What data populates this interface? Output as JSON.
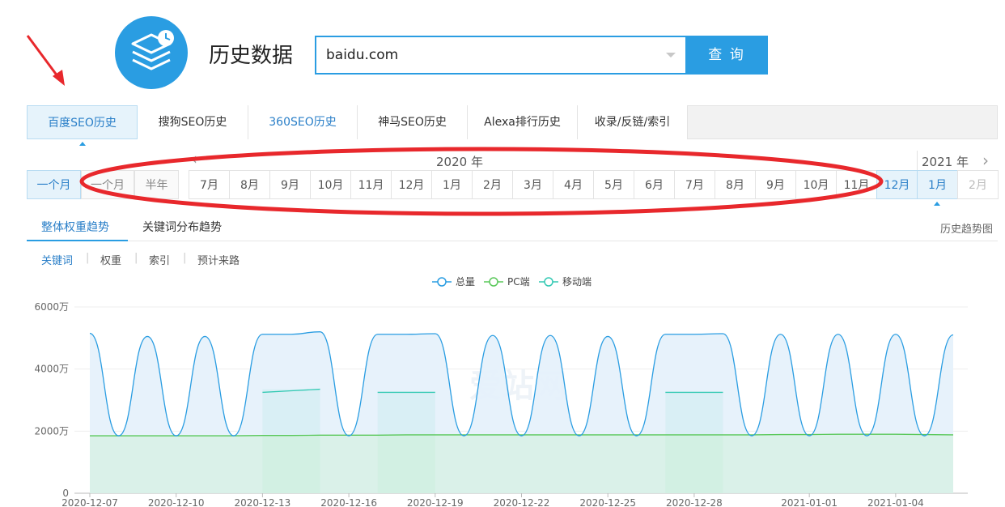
{
  "header": {
    "title": "历史数据",
    "search_value": "baidu.com",
    "search_button": "查 询"
  },
  "tabs": [
    {
      "label": "百度SEO历史",
      "state": "active"
    },
    {
      "label": "搜狗SEO历史",
      "state": "normal"
    },
    {
      "label": "360SEO历史",
      "state": "blue"
    },
    {
      "label": "神马SEO历史",
      "state": "normal"
    },
    {
      "label": "Alexa排行历史",
      "state": "normal"
    },
    {
      "label": "收录/反链/索引",
      "state": "normal"
    }
  ],
  "range": {
    "options": [
      "一个月",
      "一个月",
      "半年"
    ]
  },
  "months": {
    "year_2020": "2020 年",
    "year_2021": "2021 年",
    "list": [
      "7月",
      "8月",
      "9月",
      "10月",
      "11月",
      "12月",
      "1月",
      "2月",
      "3月",
      "4月",
      "5月",
      "6月",
      "7月",
      "8月",
      "9月",
      "10月",
      "11月",
      "12月",
      "1月",
      "2月"
    ],
    "highlighted": [
      "12月",
      "1月"
    ],
    "disabled": [
      "2月"
    ]
  },
  "subtabs": {
    "items": [
      "整体权重趋势",
      "关键词分布趋势"
    ],
    "right_label": "历史趋势图"
  },
  "filters": [
    "关键词",
    "权重",
    "索引",
    "预计来路"
  ],
  "colors": {
    "accent": "#2a9de2",
    "total": "#2a9de2",
    "pc": "#5ac85a",
    "mobile": "#33c9b3",
    "annotation": "#e8282c"
  },
  "watermark": "爱站网",
  "chart_data": {
    "type": "area",
    "legend": [
      "总量",
      "PC端",
      "移动端"
    ],
    "legend_position": "top-center",
    "y_ticks": [
      "6000万",
      "4000万",
      "2000万",
      "0"
    ],
    "ylim": [
      0,
      6000
    ],
    "unit": "万",
    "x_ticks": [
      "2020-12-07",
      "2020-12-10",
      "2020-12-13",
      "2020-12-16",
      "2020-12-19",
      "2020-12-22",
      "2020-12-25",
      "2020-12-28",
      "2021-01-01",
      "2021-01-04"
    ],
    "x": [
      "2020-12-07",
      "2020-12-08",
      "2020-12-09",
      "2020-12-10",
      "2020-12-11",
      "2020-12-12",
      "2020-12-13",
      "2020-12-14",
      "2020-12-15",
      "2020-12-16",
      "2020-12-17",
      "2020-12-18",
      "2020-12-19",
      "2020-12-20",
      "2020-12-21",
      "2020-12-22",
      "2020-12-23",
      "2020-12-24",
      "2020-12-25",
      "2020-12-26",
      "2020-12-27",
      "2020-12-28",
      "2020-12-29",
      "2020-12-30",
      "2020-12-31",
      "2021-01-01",
      "2021-01-02",
      "2021-01-03",
      "2021-01-04",
      "2021-01-05",
      "2021-01-06"
    ],
    "series": [
      {
        "name": "总量",
        "values": [
          5150,
          1850,
          5050,
          1850,
          5050,
          1850,
          5120,
          5120,
          5200,
          1850,
          5120,
          5120,
          5140,
          1850,
          5080,
          1850,
          5080,
          1850,
          5050,
          1850,
          5120,
          5120,
          5140,
          1850,
          5120,
          1850,
          5120,
          1850,
          5120,
          1850,
          5100
        ]
      },
      {
        "name": "PC端",
        "values": [
          1850,
          1850,
          1850,
          1850,
          1850,
          1850,
          1860,
          1860,
          1870,
          1870,
          1870,
          1880,
          1880,
          1880,
          1880,
          1880,
          1880,
          1880,
          1880,
          1880,
          1880,
          1880,
          1880,
          1880,
          1890,
          1890,
          1900,
          1900,
          1900,
          1890,
          1880
        ]
      },
      {
        "name": "移动端",
        "values": [
          null,
          null,
          null,
          null,
          null,
          null,
          3250,
          3300,
          3350,
          null,
          3250,
          3250,
          3250,
          null,
          null,
          null,
          null,
          null,
          null,
          null,
          3250,
          3250,
          3250,
          null,
          null,
          null,
          null,
          null,
          null,
          null,
          null
        ]
      }
    ]
  }
}
